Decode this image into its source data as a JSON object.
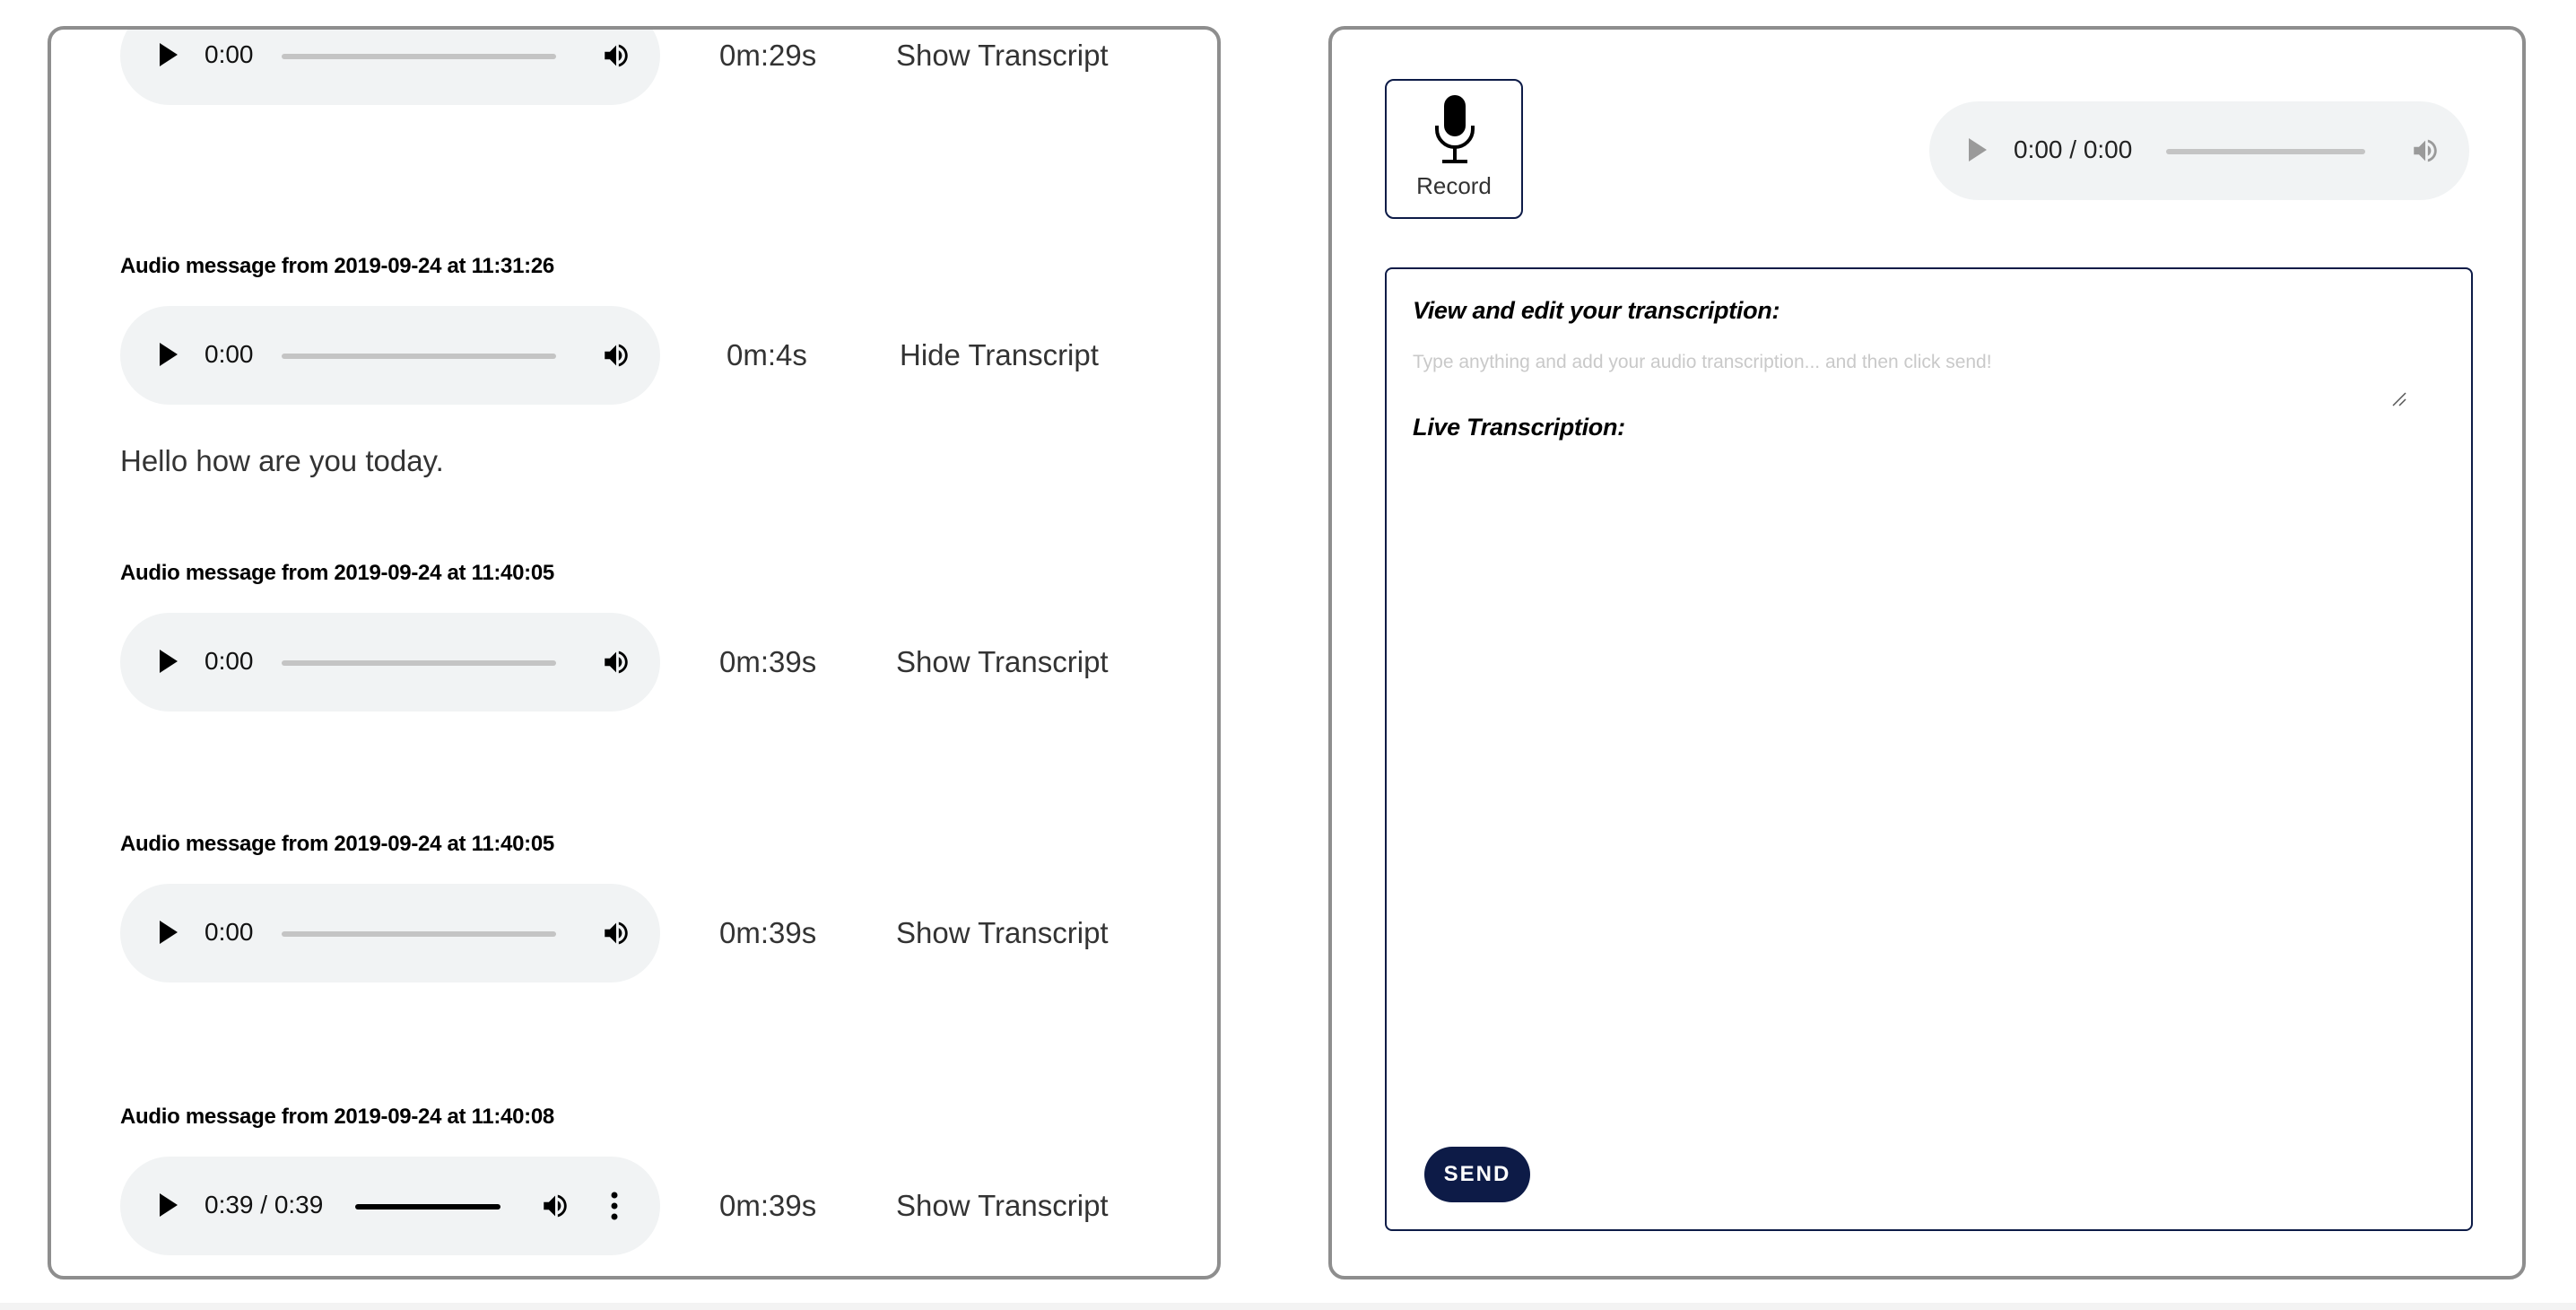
{
  "messages": [
    {
      "heading": "",
      "time": "0:00",
      "duration": "0m:29s",
      "toggle": "Show Transcript",
      "transcript": ""
    },
    {
      "heading": "Audio message from 2019-09-24 at 11:31:26",
      "time": "0:00",
      "duration": "0m:4s",
      "toggle": "Hide Transcript",
      "transcript": "Hello how are you today."
    },
    {
      "heading": "Audio message from 2019-09-24 at 11:40:05",
      "time": "0:00",
      "duration": "0m:39s",
      "toggle": "Show Transcript",
      "transcript": ""
    },
    {
      "heading": "Audio message from 2019-09-24 at 11:40:05",
      "time": "0:00",
      "duration": "0m:39s",
      "toggle": "Show Transcript",
      "transcript": ""
    },
    {
      "heading": "Audio message from 2019-09-24 at 11:40:08",
      "time": "0:39 / 0:39",
      "progress": 1.0,
      "duration": "0m:39s",
      "toggle": "Show Transcript",
      "transcript": ""
    }
  ],
  "recorder": {
    "record_label": "Record",
    "preview_time": "0:00 / 0:00"
  },
  "transcription": {
    "edit_heading": "View and edit your transcription:",
    "placeholder": "Type anything and add your audio transcription... and then click send!",
    "value": "",
    "live_heading": "Live Transcription:",
    "live_text": "",
    "send_label": "SEND"
  },
  "colors": {
    "accent": "#0d1b47",
    "player_bg": "#f1f3f4",
    "panel_border": "#8e8e8e"
  },
  "icons": [
    "play-icon",
    "volume-icon",
    "more-options-icon",
    "microphone-icon",
    "resize-handle-icon"
  ]
}
